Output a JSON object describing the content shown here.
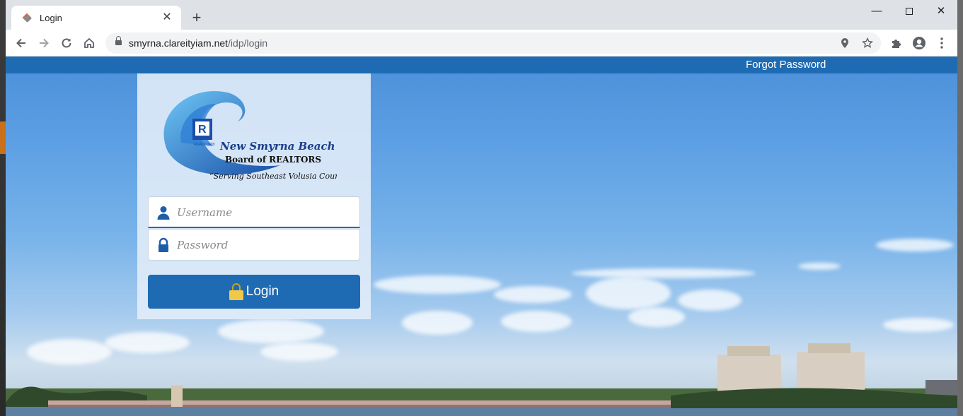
{
  "browser": {
    "tab_title": "Login",
    "new_tab_label": "+",
    "url_host": "smyrna.clareityiam.net",
    "url_path": "/idp/login"
  },
  "page": {
    "forgot_password": "Forgot Password",
    "logo": {
      "line1": "New Smyrna Beach",
      "line2": "Board of REALTORS",
      "tagline": "“Serving Southeast Volusia County”",
      "badge_text": "REALTOR®"
    },
    "username_placeholder": "Username",
    "password_placeholder": "Password",
    "login_label": "Login"
  },
  "colors": {
    "brand_blue": "#1e6bb3"
  }
}
